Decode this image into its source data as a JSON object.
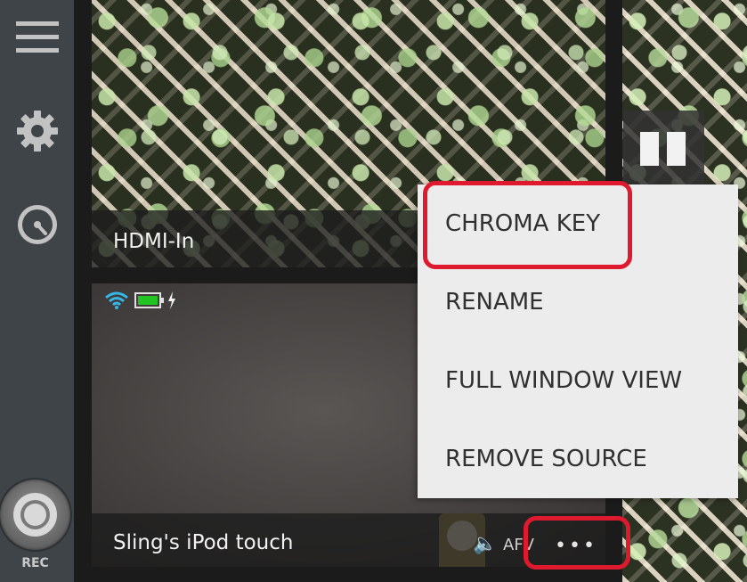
{
  "sidebar": {
    "menu_icon": "hamburger-menu-icon",
    "settings_icon": "gear-icon",
    "stats_icon": "gauge-icon",
    "record_label": "REC"
  },
  "sources": [
    {
      "name": "HDMI-In"
    },
    {
      "name": "Sling's iPod touch",
      "audio_label": "AFV",
      "more_label": "•••"
    }
  ],
  "context_menu": {
    "items": [
      {
        "label": "CHROMA KEY",
        "highlighted": true
      },
      {
        "label": "RENAME"
      },
      {
        "label": "FULL WINDOW VIEW"
      },
      {
        "label": "REMOVE SOURCE"
      }
    ]
  },
  "colors": {
    "highlight": "#e01a2e",
    "battery": "#22c322",
    "wifi": "#35b6e6",
    "sidebar": "#3f4448",
    "menu_bg": "#ececec"
  }
}
